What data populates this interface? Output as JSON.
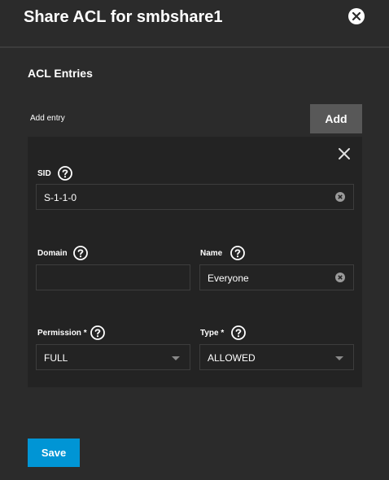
{
  "dialog": {
    "title": "Share ACL for smbshare1"
  },
  "acl": {
    "section_title": "ACL Entries",
    "add_entry_label": "Add entry",
    "add_button_label": "Add"
  },
  "entry": {
    "sid": {
      "label": "SID",
      "value": "S-1-1-0"
    },
    "domain": {
      "label": "Domain",
      "value": ""
    },
    "name": {
      "label": "Name",
      "value": "Everyone"
    },
    "permission": {
      "label": "Permission *",
      "value": "FULL"
    },
    "type": {
      "label": "Type *",
      "value": "ALLOWED"
    }
  },
  "footer": {
    "save_label": "Save"
  },
  "colors": {
    "accent": "#0095d5",
    "background": "#2b2b2b",
    "card": "#232323"
  }
}
